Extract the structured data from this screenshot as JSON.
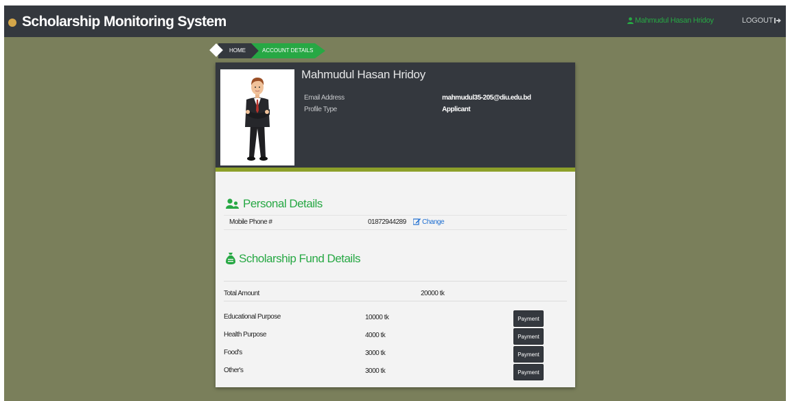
{
  "navbar": {
    "brand_title": "Scholarship Monitoring System",
    "user_name": "Mahmudul Hasan Hridoy",
    "logout_label": "LOGOUT"
  },
  "breadcrumb": {
    "home": "HOME",
    "current": "ACCOUNT DETAILS"
  },
  "profile": {
    "name": "Mahmudul Hasan Hridoy",
    "email_label": "Email Address",
    "email_value": "mahmudul35-205@diu.edu.bd",
    "type_label": "Profile Type",
    "type_value": "Applicant"
  },
  "personal_details": {
    "title": "Personal Details",
    "mobile_label": "Mobile Phone #",
    "mobile_value": "01872944289",
    "change_label": "Change"
  },
  "fund_details": {
    "title": "Scholarship Fund Details",
    "total_label": "Total Amount",
    "total_value": "20000 tk",
    "rows": [
      {
        "label": "Educational Purpose",
        "amount": "10000 tk",
        "button": "Payment"
      },
      {
        "label": "Health Purpose",
        "amount": "4000 tk",
        "button": "Payment"
      },
      {
        "label": "Food's",
        "amount": "3000 tk",
        "button": "Payment"
      },
      {
        "label": "Other's",
        "amount": "3000 tk",
        "button": "Payment"
      }
    ]
  },
  "colors": {
    "navbar": "#34383e",
    "page_background": "#7a7f5b",
    "accent_green": "#27a844",
    "header_underline": "#8da02a",
    "link_blue": "#1f6fd1"
  },
  "icons": {
    "brand": "shield-badge-icon",
    "user": "user-icon",
    "logout": "sign-out-icon",
    "personal": "users-icon",
    "fund": "money-bag-icon",
    "change": "edit-icon"
  }
}
